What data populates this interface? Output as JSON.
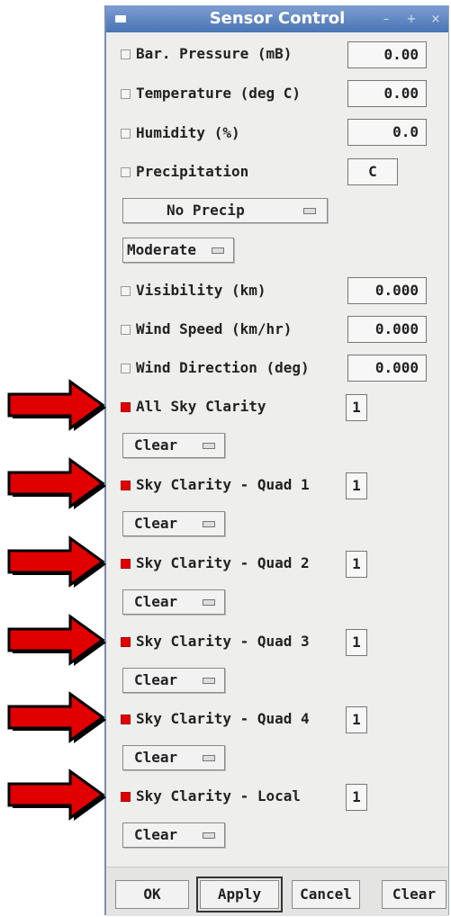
{
  "window": {
    "title": "Sensor Control",
    "minimize": "–",
    "maximize": "+",
    "close": "×"
  },
  "fields": {
    "pressure": {
      "label": "Bar. Pressure (mB)",
      "value": "0.00",
      "checked": false
    },
    "temperature": {
      "label": "Temperature (deg C)",
      "value": "0.00",
      "checked": false
    },
    "humidity": {
      "label": "Humidity (%)",
      "value": "0.0",
      "checked": false
    },
    "precip": {
      "label": "Precipitation",
      "value": "C",
      "checked": false
    },
    "visibility": {
      "label": "Visibility (km)",
      "value": "0.000",
      "checked": false
    },
    "wind_speed": {
      "label": "Wind Speed (km/hr)",
      "value": "0.000",
      "checked": false
    },
    "wind_dir": {
      "label": "Wind Direction (deg)",
      "value": "0.000",
      "checked": false
    }
  },
  "precip_type": "No Precip",
  "precip_intensity": "Moderate",
  "sky": [
    {
      "label": "All Sky Clarity",
      "value": "1",
      "option": "Clear",
      "checked": true
    },
    {
      "label": "Sky Clarity - Quad 1",
      "value": "1",
      "option": "Clear",
      "checked": true
    },
    {
      "label": "Sky Clarity - Quad 2",
      "value": "1",
      "option": "Clear",
      "checked": true
    },
    {
      "label": "Sky Clarity - Quad 3",
      "value": "1",
      "option": "Clear",
      "checked": true
    },
    {
      "label": "Sky Clarity - Quad 4",
      "value": "1",
      "option": "Clear",
      "checked": true
    },
    {
      "label": "Sky Clarity - Local",
      "value": "1",
      "option": "Clear",
      "checked": true
    }
  ],
  "buttons": {
    "ok": "OK",
    "apply": "Apply",
    "cancel": "Cancel",
    "clear": "Clear"
  },
  "colors": {
    "title_bar": "#4a74b5",
    "checked": "#e00000",
    "arrow": "#e00000"
  }
}
